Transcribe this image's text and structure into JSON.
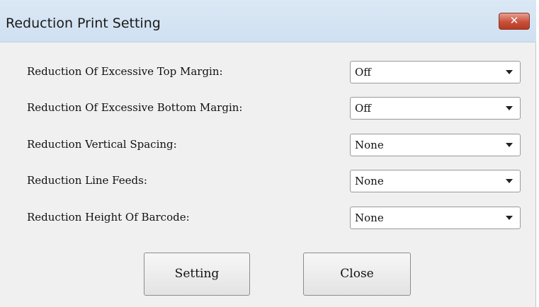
{
  "window": {
    "title": "Reduction Print Setting",
    "close_glyph": "✕"
  },
  "settings": [
    {
      "label": "Reduction Of Excessive Top Margin:",
      "value": "Off"
    },
    {
      "label": "Reduction Of Excessive Bottom Margin:",
      "value": "Off"
    },
    {
      "label": "Reduction Vertical Spacing:",
      "value": "None"
    },
    {
      "label": "Reduction Line Feeds:",
      "value": "None"
    },
    {
      "label": "Reduction Height Of Barcode:",
      "value": "None"
    }
  ],
  "buttons": {
    "setting": "Setting",
    "close": "Close"
  },
  "colors": {
    "titlebar": "#d6e5f4",
    "close_button": "#c7503a",
    "dialog_background": "#f0f0f0"
  },
  "icons": {
    "close": "close-icon",
    "dropdown": "chevron-down-icon"
  }
}
